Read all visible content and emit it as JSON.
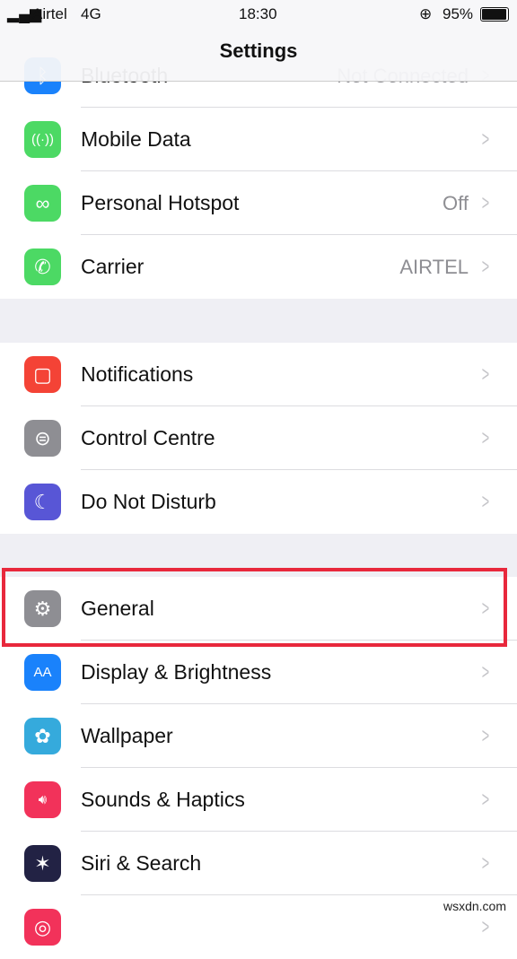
{
  "status_bar": {
    "carrier": "Airtel",
    "network": "4G",
    "time": "18:30",
    "battery": "95%"
  },
  "header": {
    "title": "Settings"
  },
  "groups": [
    [
      {
        "label": "Bluetooth",
        "value": "Not Connected",
        "icon": "bluetooth-icon",
        "color": "#1a82fb"
      },
      {
        "label": "Mobile Data",
        "value": "",
        "icon": "antenna-icon",
        "color": "#4cd964"
      },
      {
        "label": "Personal Hotspot",
        "value": "Off",
        "icon": "hotspot-icon",
        "color": "#4cd964"
      },
      {
        "label": "Carrier",
        "value": "AIRTEL",
        "icon": "phone-icon",
        "color": "#4cd964"
      }
    ],
    [
      {
        "label": "Notifications",
        "value": "",
        "icon": "notifications-icon",
        "color": "#f44336"
      },
      {
        "label": "Control Centre",
        "value": "",
        "icon": "toggles-icon",
        "color": "#8e8e93"
      },
      {
        "label": "Do Not Disturb",
        "value": "",
        "icon": "moon-icon",
        "color": "#5856d6"
      }
    ],
    [
      {
        "label": "General",
        "value": "",
        "icon": "gear-icon",
        "color": "#8e8e93"
      },
      {
        "label": "Display & Brightness",
        "value": "",
        "icon": "text-size-icon",
        "color": "#1a82fb"
      },
      {
        "label": "Wallpaper",
        "value": "",
        "icon": "flower-icon",
        "color": "#35aadc"
      },
      {
        "label": "Sounds & Haptics",
        "value": "",
        "icon": "speaker-icon",
        "color": "#f2325a"
      },
      {
        "label": "Siri & Search",
        "value": "",
        "icon": "siri-icon",
        "color": "#222244"
      },
      {
        "label": "",
        "value": "",
        "icon": "touch-id-icon",
        "color": "#f2325a"
      }
    ]
  ],
  "watermark": "wsxdn.com"
}
